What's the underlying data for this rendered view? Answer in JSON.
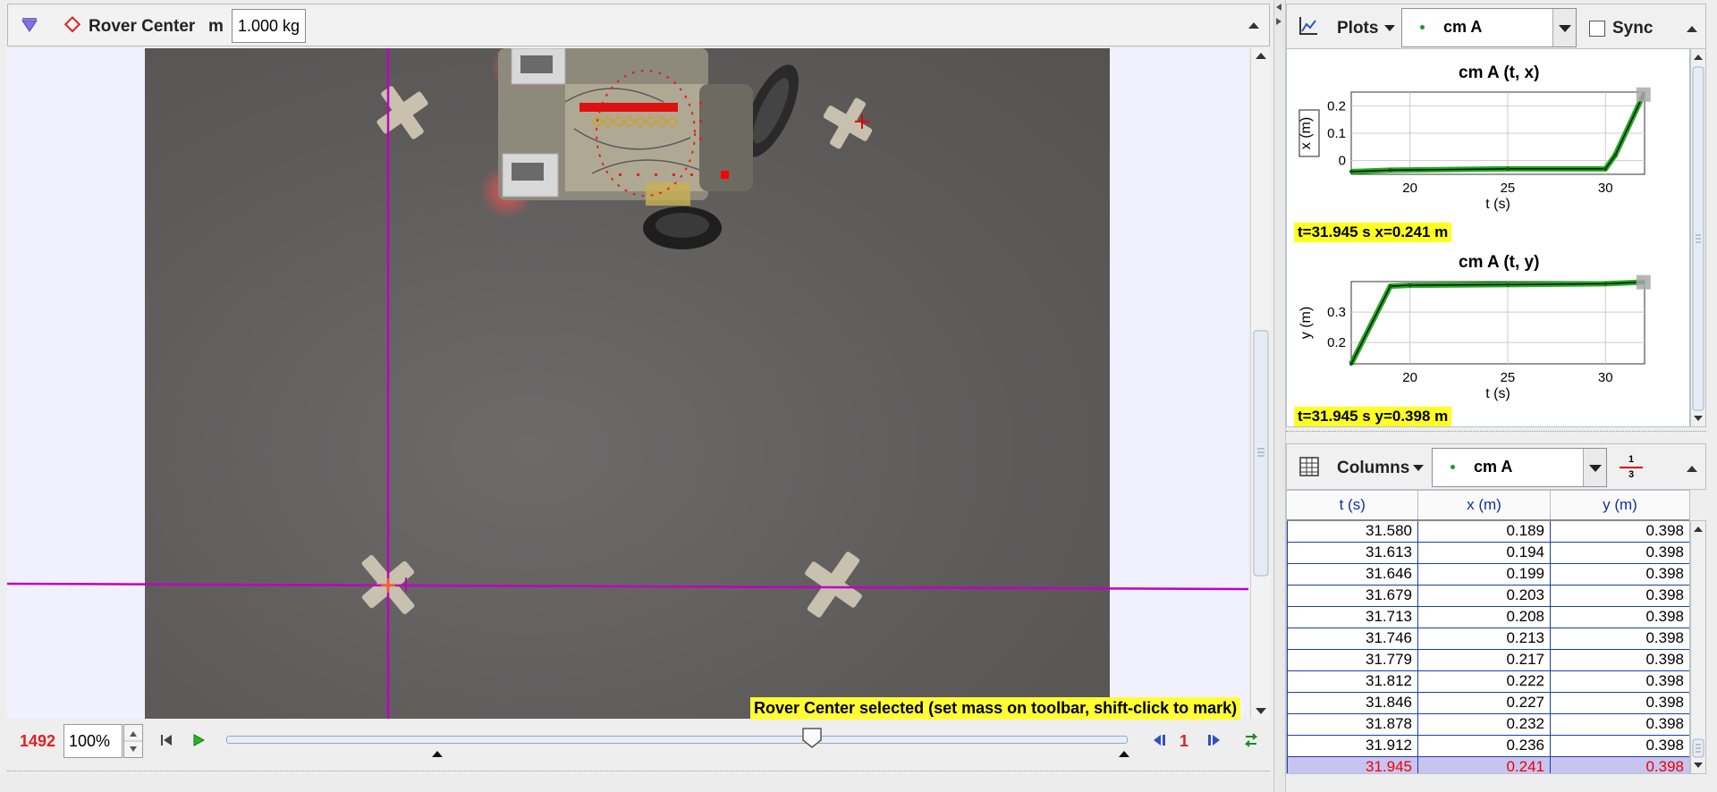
{
  "toolbar": {
    "track_name": "Rover Center",
    "mass_label": "m",
    "mass_value": "1.000 kg"
  },
  "video": {
    "status_message": "Rover Center selected (set mass on toolbar, shift-click to mark)"
  },
  "player": {
    "frame_number": "1492",
    "zoom": "100%",
    "step_size": "1",
    "slider_position": 0.65
  },
  "plots_toolbar": {
    "menu_label": "Plots",
    "track_select": "cm A",
    "sync_label": "Sync"
  },
  "plots": [
    {
      "title": "cm A (t, x)",
      "ylabel": "x (m)",
      "xlabel": "t (s)",
      "x_ticks": [
        "20",
        "25",
        "30"
      ],
      "y_ticks": [
        "0.2",
        "0.1",
        "0"
      ],
      "readout": "t=31.945 s  x=0.241 m"
    },
    {
      "title": "cm A (t, y)",
      "ylabel": "y (m)",
      "xlabel": "t (s)",
      "x_ticks": [
        "20",
        "25",
        "30"
      ],
      "y_ticks": [
        "0.3",
        "0.2"
      ],
      "readout": "t=31.945 s  y=0.398 m"
    }
  ],
  "chart_data": [
    {
      "type": "line",
      "title": "cm A (t, x)",
      "xlabel": "t (s)",
      "ylabel": "x (m)",
      "xlim": [
        17,
        32
      ],
      "ylim": [
        -0.05,
        0.25
      ],
      "series": [
        {
          "x": [
            17,
            19,
            25,
            30,
            30.5,
            31.945
          ],
          "y": [
            -0.04,
            -0.035,
            -0.03,
            -0.03,
            0.02,
            0.241
          ]
        }
      ]
    },
    {
      "type": "line",
      "title": "cm A (t, y)",
      "xlabel": "t (s)",
      "ylabel": "y (m)",
      "xlim": [
        17,
        32
      ],
      "ylim": [
        0.13,
        0.4
      ],
      "series": [
        {
          "x": [
            17,
            19,
            20,
            25,
            30,
            31.945
          ],
          "y": [
            0.13,
            0.385,
            0.388,
            0.39,
            0.393,
            0.398
          ]
        }
      ]
    }
  ],
  "table_toolbar": {
    "menu_label": "Columns",
    "track_select": "cm A",
    "format_numerator": "1",
    "format_denominator": "3"
  },
  "table": {
    "headers": [
      "t (s)",
      "x (m)",
      "y (m)"
    ],
    "rows": [
      [
        "31.580",
        "0.189",
        "0.398"
      ],
      [
        "31.613",
        "0.194",
        "0.398"
      ],
      [
        "31.646",
        "0.199",
        "0.398"
      ],
      [
        "31.679",
        "0.203",
        "0.398"
      ],
      [
        "31.713",
        "0.208",
        "0.398"
      ],
      [
        "31.746",
        "0.213",
        "0.398"
      ],
      [
        "31.779",
        "0.217",
        "0.398"
      ],
      [
        "31.812",
        "0.222",
        "0.398"
      ],
      [
        "31.846",
        "0.227",
        "0.398"
      ],
      [
        "31.878",
        "0.232",
        "0.398"
      ],
      [
        "31.912",
        "0.236",
        "0.398"
      ],
      [
        "31.945",
        "0.241",
        "0.398"
      ]
    ],
    "selected_index": 11
  },
  "colors": {
    "axis_magenta": "#c000c0",
    "plot_green": "#22aa22",
    "readout_yellow": "#ffff22",
    "frame_red": "#dd2222"
  }
}
